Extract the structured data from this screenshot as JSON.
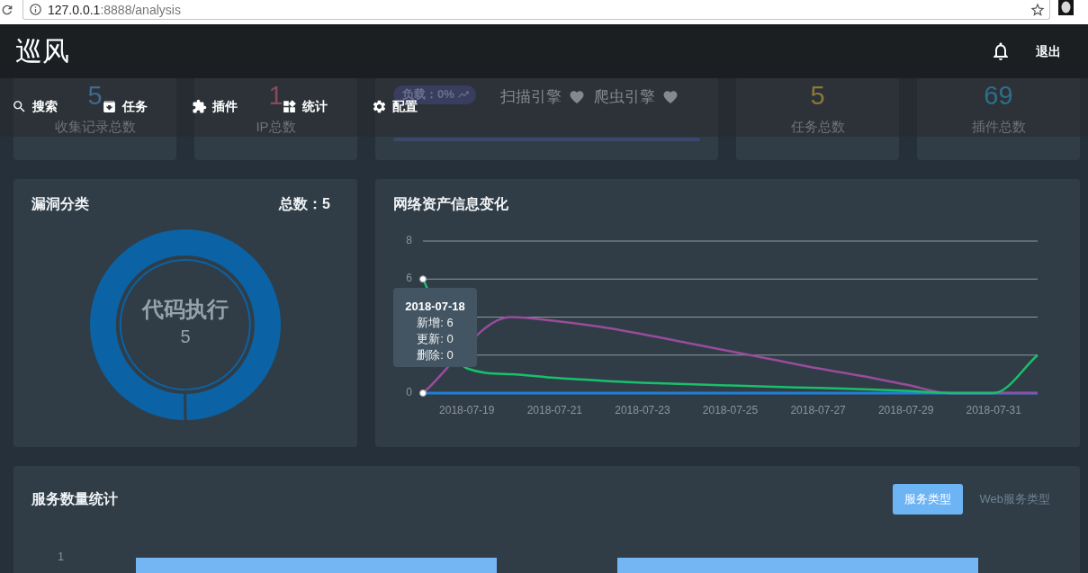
{
  "browser": {
    "url_host": "127.0.0.1",
    "url_path": ":8888/analysis"
  },
  "header": {
    "logo": "巡风",
    "logout": "退出"
  },
  "nav": [
    {
      "label": "搜索"
    },
    {
      "label": "任务"
    },
    {
      "label": "插件"
    },
    {
      "label": "统计"
    },
    {
      "label": "配置"
    }
  ],
  "stats": [
    {
      "kind": "count",
      "value": "5",
      "label": "收集记录总数",
      "color": "#41688f"
    },
    {
      "kind": "count",
      "value": "1",
      "label": "IP总数",
      "color": "#8a4a5e"
    },
    {
      "kind": "engines",
      "load": "负载：0%",
      "engines": [
        "扫描引擎",
        "爬虫引擎"
      ],
      "level": 0
    },
    {
      "kind": "count",
      "value": "5",
      "label": "任务总数",
      "color": "#8d7836"
    },
    {
      "kind": "count",
      "value": "69",
      "label": "插件总数",
      "color": "#2e6f8c"
    }
  ],
  "vuln_panel": {
    "title": "漏洞分类",
    "total": "总数：5",
    "chart_data": {
      "type": "donut",
      "categories": [
        "代码执行"
      ],
      "values": [
        100
      ]
    },
    "center_value": "5"
  },
  "assets_panel": {
    "title": "网络资产信息变化",
    "chart_data": {
      "type": "line",
      "categories": [
        null,
        "2018-07-19",
        null,
        "2018-07-21",
        null,
        "2018-07-23",
        null,
        "2018-07-25",
        null,
        "2018-07-27",
        null,
        "2018-07-29",
        null,
        "2018-07-31",
        null
      ],
      "series": [
        {
          "color": "#19c06b",
          "values": [
            6,
            1.3,
            1.0,
            0.8,
            0.66,
            0.55,
            0.47,
            0.4,
            0.33,
            0.27,
            0.2,
            0.12,
            0,
            0,
            2
          ]
        },
        {
          "color": "#984c9b",
          "values": [
            0,
            null,
            4.0,
            3.8,
            3.5,
            3.1,
            2.65,
            2.2,
            1.75,
            1.3,
            0.9,
            0.45,
            0,
            0,
            0
          ]
        },
        {
          "color": "#1f80d8",
          "values": [
            0,
            0,
            0,
            0,
            0,
            0,
            0,
            0,
            0,
            0,
            0,
            0,
            0,
            0,
            0
          ]
        }
      ],
      "ylim": [
        0,
        8
      ],
      "yticks": [
        0,
        6,
        8
      ]
    },
    "tooltip": {
      "hover_markers": true,
      "title": "2018-07-18",
      "rows": [
        "新增: 6",
        "更新: 0",
        "删除: 0"
      ]
    }
  },
  "services": {
    "title": "服务数量统计",
    "tabs": [
      {
        "label": "服务类型",
        "selected": true
      },
      {
        "label": "Web服务类型",
        "selected": false
      }
    ],
    "y_tick": "1"
  }
}
